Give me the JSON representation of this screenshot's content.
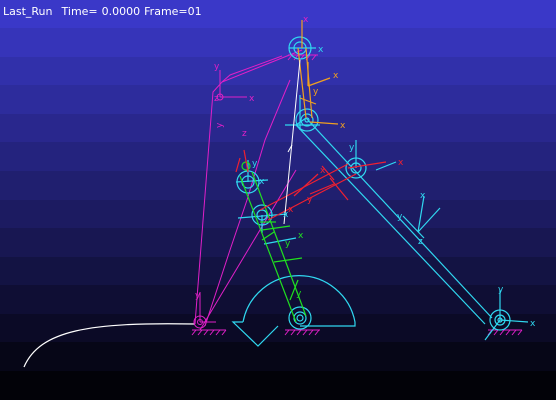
{
  "viewport": {
    "background": {
      "top_color": "#3a38c8",
      "bottom_color": "#020208",
      "band_count": 14
    }
  },
  "status_bar": {
    "analysis_name": "Last_Run",
    "time_label": "Time=",
    "time_value": "0.0000",
    "frame_label": "Frame=",
    "frame_value": "01"
  },
  "axis_labels": {
    "x": "x",
    "y": "y",
    "z": "z"
  },
  "colors": {
    "magenta_part": "#e020c8",
    "cyan_part": "#30d8f0",
    "green_part": "#20e020",
    "red_part": "#f02030",
    "orange_part": "#f0a020",
    "white_part": "#ffffff",
    "ground_hatch": "#e020c8"
  }
}
